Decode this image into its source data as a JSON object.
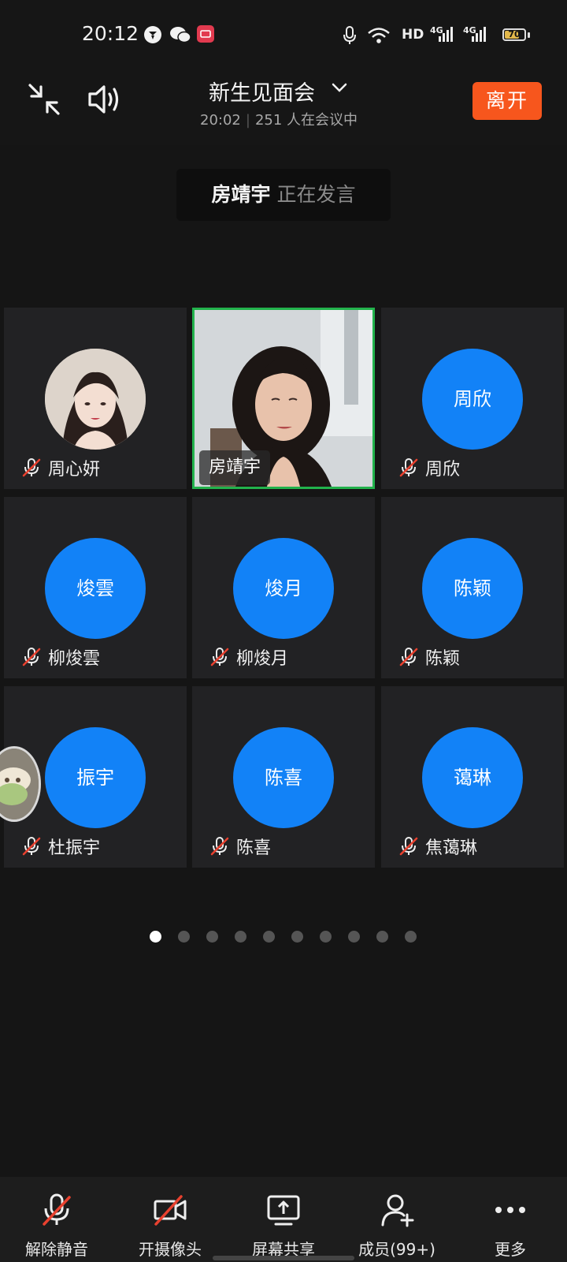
{
  "status_bar": {
    "time": "20:12",
    "network": "HD",
    "signal_1": "4G",
    "signal_2": "4G",
    "battery": "70"
  },
  "header": {
    "title": "新生见面会",
    "start_time": "20:02",
    "participants": "251 人在会议中",
    "leave_label": "离开"
  },
  "speaker_banner": {
    "name": "房靖宇",
    "status": "正在发言"
  },
  "participants": [
    {
      "name": "周心妍",
      "avatar": "",
      "muted": true,
      "photo": true
    },
    {
      "name": "房靖宇",
      "avatar": "",
      "muted": false,
      "video": true
    },
    {
      "name": "周欣",
      "avatar": "周欣",
      "muted": true
    },
    {
      "name": "柳焌雲",
      "avatar": "焌雲",
      "muted": true
    },
    {
      "name": "柳焌月",
      "avatar": "焌月",
      "muted": true
    },
    {
      "name": "陈颖",
      "avatar": "陈颖",
      "muted": true
    },
    {
      "name": "杜振宇",
      "avatar": "振宇",
      "muted": true
    },
    {
      "name": "陈喜",
      "avatar": "陈喜",
      "muted": true
    },
    {
      "name": "焦蔼琳",
      "avatar": "蔼琳",
      "muted": true
    }
  ],
  "pagination": {
    "total": 10,
    "current": 1
  },
  "toolbar": {
    "unmute": "解除静音",
    "camera": "开摄像头",
    "share": "屏幕共享",
    "members": "成员(99+)",
    "more": "更多"
  },
  "colors": {
    "accent_blue": "#1282f7",
    "leave_orange": "#f7561d",
    "active_speaker_border": "#22b24c",
    "muted_red": "#e8412f"
  }
}
